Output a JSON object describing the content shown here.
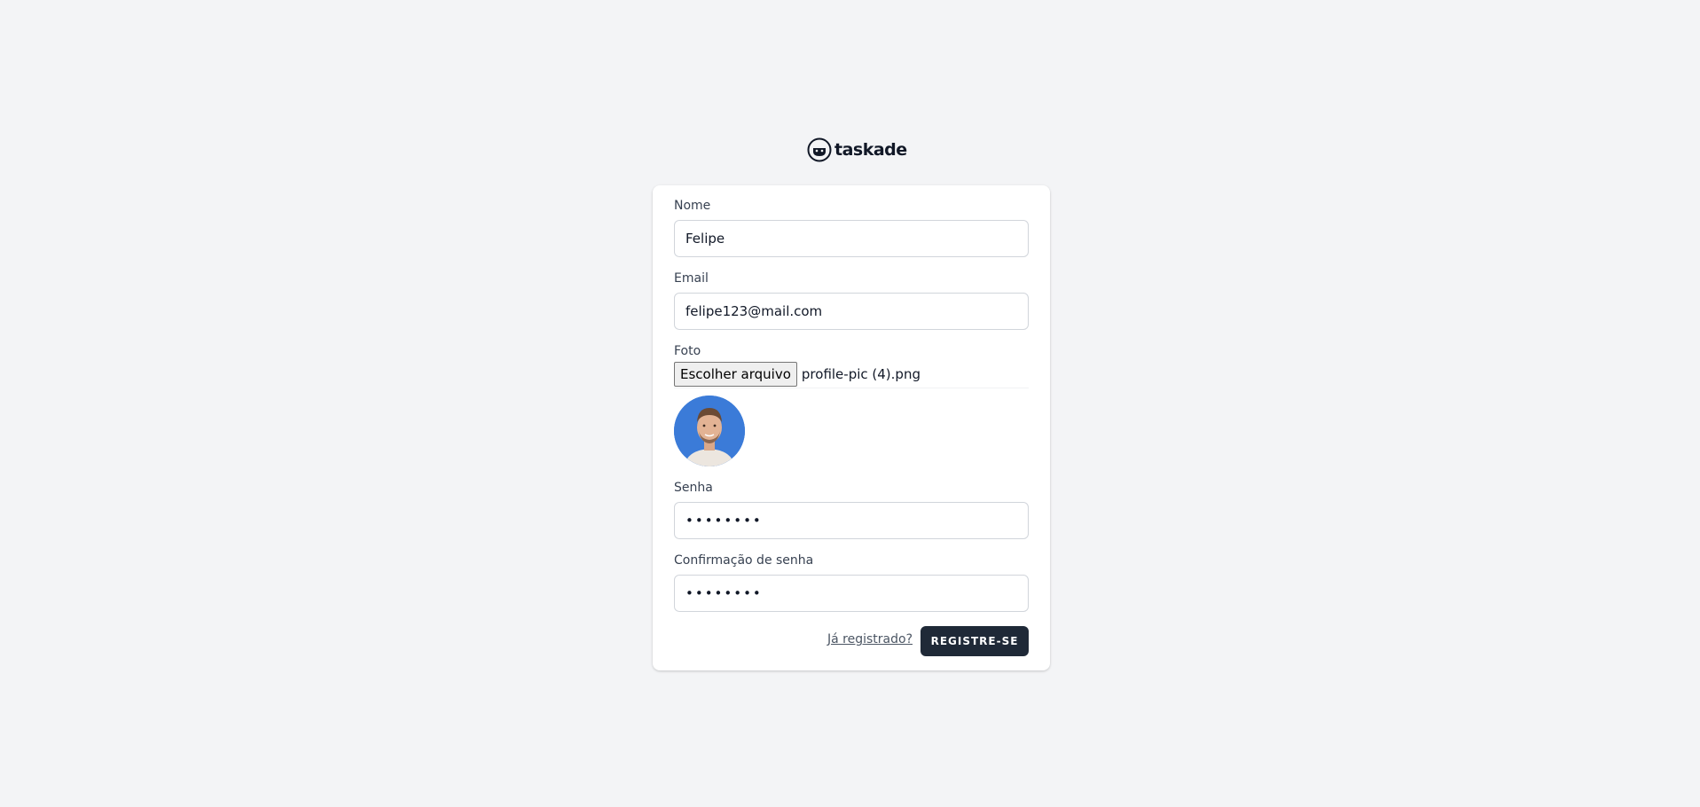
{
  "brand": {
    "logo_text": "taskade",
    "logo_icon": "taskade-logo-icon"
  },
  "form": {
    "name": {
      "label": "Nome",
      "value": "Felipe"
    },
    "email": {
      "label": "Email",
      "value": "felipe123@mail.com"
    },
    "photo": {
      "label": "Foto",
      "button_label": "Escolher arquivo",
      "file_name": "profile-pic (4).png"
    },
    "password": {
      "label": "Senha",
      "value": "••••••••"
    },
    "password_confirm": {
      "label": "Confirmação de senha",
      "value": "••••••••"
    },
    "login_link": "Já registrado?",
    "submit_label": "REGISTRE-SE"
  },
  "colors": {
    "background": "#f3f4f6",
    "card": "#ffffff",
    "button": "#1f2937",
    "avatar_bg": "#3b7bd8"
  }
}
